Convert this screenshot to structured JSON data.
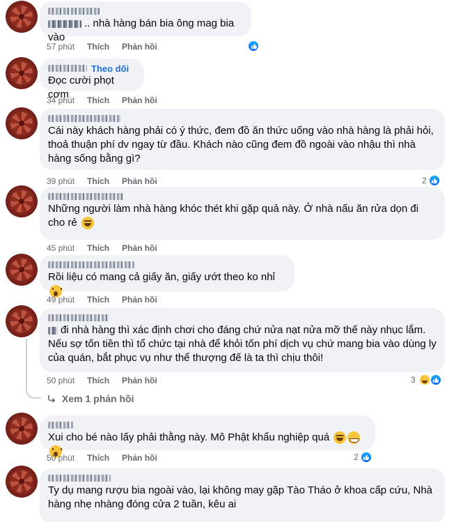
{
  "comments": [
    {
      "follow": "",
      "author_suffix": "",
      "text": ".. nhà hàng bán bia ông mag bia vào",
      "time": "57 phút",
      "like": "Thích",
      "reply": "Phản hồi",
      "reactions": {
        "count": "",
        "types": [
          "like"
        ]
      }
    },
    {
      "follow": "Theo dõi",
      "text": "Đọc cười phọt cơm",
      "time": "34 phút",
      "like": "Thích",
      "reply": "Phản hồi"
    },
    {
      "text": "Cái này khách hàng phải có ý thức, đem đồ ăn thức uống vào nhà hàng là phải hỏi, thoả thuận phí dv ngay từ đầu. Khách nào cũng đem đồ ngoài vào nhậu thì nhà hàng sống bằng gì?",
      "time": "39 phút",
      "like": "Thích",
      "reply": "Phản hồi",
      "reactions": {
        "count": "2",
        "types": [
          "like"
        ]
      }
    },
    {
      "text": "Những người làm nhà hàng khóc thét khi gặp quả này. Ở nhà nấu ăn rửa dọn đi cho rẻ",
      "time": "45 phút",
      "like": "Thích",
      "reply": "Phản hồi"
    },
    {
      "text": "Rồi liệu có mang cả giấy ăn, giấy ướt theo ko nhỉ",
      "time": "49 phút",
      "like": "Thích",
      "reply": "Phản hồi"
    },
    {
      "text": "đi nhà hàng thì xác định chơi cho đáng chứ nửa nạt nửa mỡ thế này nhục lắm. Nếu sợ tốn tiền thì tổ chức tại nhà để khỏi tốn phí dịch vụ chứ mang bia vào dùng ly của quán, bắt phục vụ như thể thượng đế là ta thì chịu thôi!",
      "time": "50 phút",
      "like": "Thích",
      "reply": "Phản hồi",
      "reactions": {
        "count": "3",
        "types": [
          "haha",
          "like"
        ]
      },
      "view_replies": "Xem 1 phản hồi"
    },
    {
      "text": "Xui cho bé nào lấy phải thằng này. Mô Phật khẩu nghiệp quá",
      "time": "50 phút",
      "like": "Thích",
      "reply": "Phản hồi",
      "reactions": {
        "count": "2",
        "types": [
          "like"
        ]
      }
    },
    {
      "text": "Ty dụ mang rượu bia ngoài vào, lại không may gặp Tào Tháo ở khoa cấp cứu, Nhà hàng nhẹ nhàng đóng cửa 2 tuần, kêu ai"
    }
  ],
  "colors": {
    "like_blue": "#0866ff",
    "bubble": "#f0f2f5",
    "meta": "#65676b",
    "follow": "#216fdb"
  }
}
